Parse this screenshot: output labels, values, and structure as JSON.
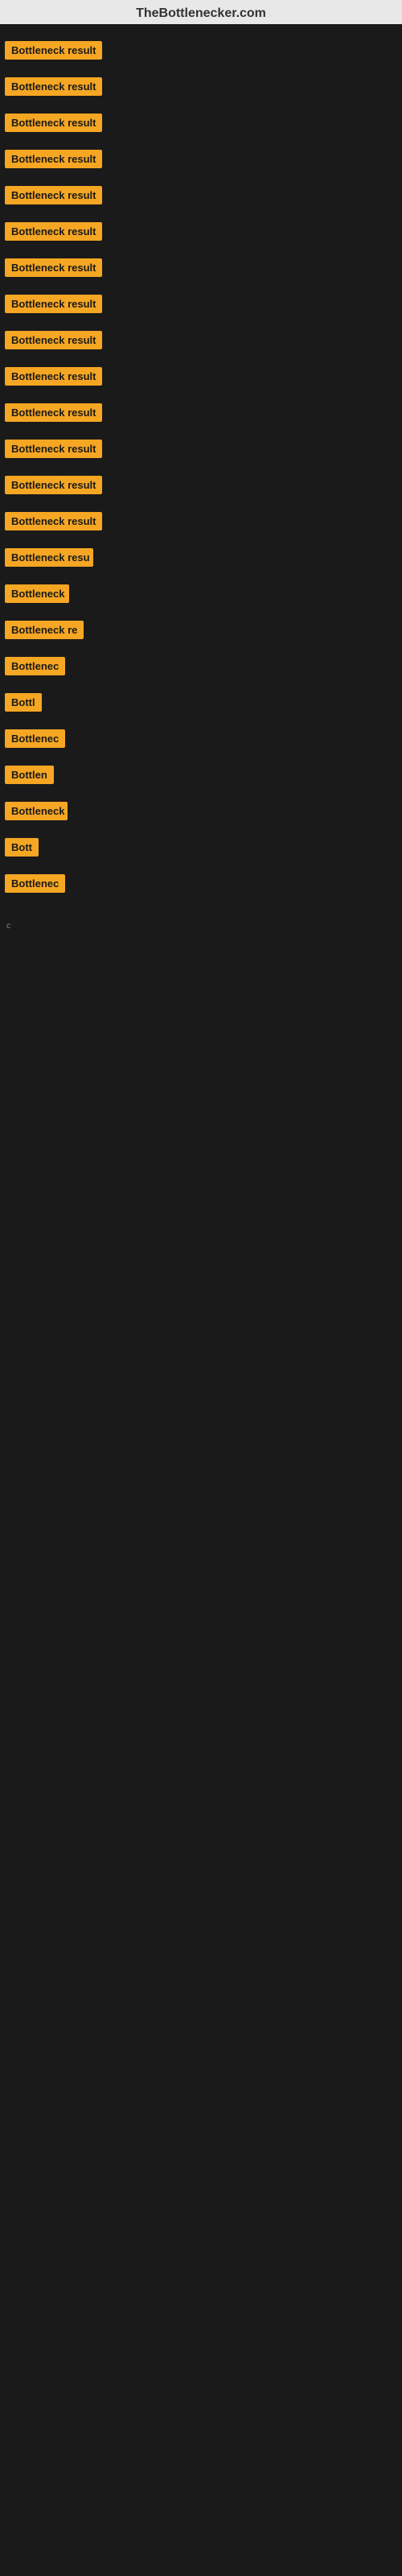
{
  "header": {
    "title": "TheBottlenecker.com"
  },
  "rows": [
    {
      "id": 1,
      "label": "Bottleneck result"
    },
    {
      "id": 2,
      "label": "Bottleneck result"
    },
    {
      "id": 3,
      "label": "Bottleneck result"
    },
    {
      "id": 4,
      "label": "Bottleneck result"
    },
    {
      "id": 5,
      "label": "Bottleneck result"
    },
    {
      "id": 6,
      "label": "Bottleneck result"
    },
    {
      "id": 7,
      "label": "Bottleneck result"
    },
    {
      "id": 8,
      "label": "Bottleneck result"
    },
    {
      "id": 9,
      "label": "Bottleneck result"
    },
    {
      "id": 10,
      "label": "Bottleneck result"
    },
    {
      "id": 11,
      "label": "Bottleneck result"
    },
    {
      "id": 12,
      "label": "Bottleneck result"
    },
    {
      "id": 13,
      "label": "Bottleneck result"
    },
    {
      "id": 14,
      "label": "Bottleneck result"
    },
    {
      "id": 15,
      "label": "Bottleneck resu"
    },
    {
      "id": 16,
      "label": "Bottleneck"
    },
    {
      "id": 17,
      "label": "Bottleneck re"
    },
    {
      "id": 18,
      "label": "Bottlenec"
    },
    {
      "id": 19,
      "label": "Bottl"
    },
    {
      "id": 20,
      "label": "Bottlenec"
    },
    {
      "id": 21,
      "label": "Bottlen"
    },
    {
      "id": 22,
      "label": "Bottleneck"
    },
    {
      "id": 23,
      "label": "Bott"
    },
    {
      "id": 24,
      "label": "Bottlenec"
    }
  ],
  "small_label": "c",
  "colors": {
    "badge_bg": "#f5a623",
    "badge_text": "#1a1a1a",
    "page_bg": "#1a1a1a",
    "header_bg": "#e8e8e8",
    "header_text": "#333333"
  }
}
